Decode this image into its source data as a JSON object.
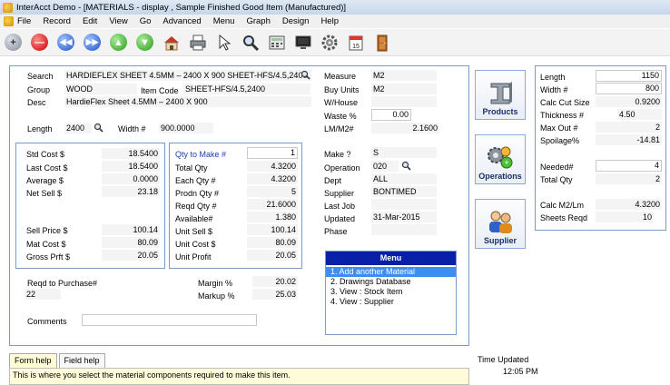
{
  "window": {
    "title": "InterAcct Demo - [MATERIALS - display , Sample Finished Good Item (Manufactured)]"
  },
  "menu": [
    "File",
    "Record",
    "Edit",
    "View",
    "Go",
    "Advanced",
    "Menu",
    "Graph",
    "Design",
    "Help"
  ],
  "toolbar": [
    "add-icon",
    "delete-icon",
    "first-icon",
    "last-icon",
    "previous-icon",
    "next-icon",
    "home-icon",
    "print-icon",
    "pointer-icon",
    "find-icon",
    "calculator-icon",
    "monitor-icon",
    "settings-icon",
    "calendar-icon",
    "exit-door-icon"
  ],
  "main": {
    "search": {
      "label": "Search",
      "value": "HARDIEFLEX SHEET 4.5MM – 2400 X 900 SHEET-HFS/4.5,2400"
    },
    "group": {
      "label": "Group",
      "value": "WOOD"
    },
    "item_code": {
      "label": "Item Code",
      "value": "SHEET-HFS/4.5,2400"
    },
    "desc": {
      "label": "Desc",
      "value": "HardieFlex Sheet 4.5MM – 2400 X 900"
    },
    "length": {
      "label": "Length",
      "value": "2400"
    },
    "width": {
      "label": "Width #",
      "value": "900.0000"
    },
    "measure": {
      "label": "Measure",
      "value": "M2"
    },
    "buy_units": {
      "label": "Buy Units",
      "value": "M2"
    },
    "w_house": {
      "label": "W/House",
      "value": ""
    },
    "waste": {
      "label": "Waste %",
      "value": "0.00"
    },
    "lm_m2": {
      "label": "LM/M2#",
      "value": "2.1600"
    }
  },
  "costs": {
    "std_cost": {
      "label": "Std Cost  $",
      "value": "18.5400"
    },
    "last_cost": {
      "label": "Last Cost  $",
      "value": "18.5400"
    },
    "average": {
      "label": "Average  $",
      "value": "0.0000"
    },
    "net_sell": {
      "label": "Net Sell  $",
      "value": "23.18"
    },
    "sell_price": {
      "label": "Sell Price $",
      "value": "100.14"
    },
    "mat_cost": {
      "label": "Mat Cost  $",
      "value": "80.09"
    },
    "gross_prft": {
      "label": "Gross Prft $",
      "value": "20.05"
    }
  },
  "qty": {
    "qty_to_make": {
      "label": "Qty to Make #",
      "value": "1"
    },
    "total_qty": {
      "label": "Total Qty",
      "value": "4.3200"
    },
    "each_qty": {
      "label": "Each Qty #",
      "value": "4.3200"
    },
    "prodn_qty": {
      "label": "Prodn Qty #",
      "value": "5"
    },
    "reqd_qty": {
      "label": "Reqd Qty #",
      "value": "21.6000"
    },
    "available": {
      "label": "Available#",
      "value": "1.380"
    },
    "unit_sell": {
      "label": "Unit Sell $",
      "value": "100.14"
    },
    "unit_cost": {
      "label": "Unit Cost $",
      "value": "80.09"
    },
    "unit_profit": {
      "label": "Unit Profit",
      "value": "20.05"
    }
  },
  "make": {
    "make": {
      "label": "Make ?",
      "value": "S"
    },
    "operation": {
      "label": "Operation",
      "value": "020"
    },
    "dept": {
      "label": "Dept",
      "value": "ALL"
    },
    "supplier": {
      "label": "Supplier",
      "value": "BONTIMED"
    },
    "last_job": {
      "label": "Last Job",
      "value": ""
    },
    "updated": {
      "label": "Updated",
      "value": "31-Mar-2015"
    },
    "phase": {
      "label": "Phase",
      "value": ""
    }
  },
  "bottom": {
    "reqd_purchase": {
      "label": "Reqd to Purchase#",
      "value": "22"
    },
    "margin": {
      "label": "Margin %",
      "value": "20.02"
    },
    "markup": {
      "label": "Markup %",
      "value": "25.03"
    },
    "comments": {
      "label": "Comments",
      "value": ""
    }
  },
  "actions": {
    "products": "Products",
    "operations": "Operations",
    "supplier": "Supplier"
  },
  "menu_panel": {
    "title": "Menu",
    "items": [
      "1. Add another Material",
      "2. Drawings Database",
      "3. View  : Stock Item",
      "4. View  : Supplier"
    ]
  },
  "right": {
    "length": {
      "label": "Length",
      "value": "1150"
    },
    "width": {
      "label": "Width #",
      "value": "800"
    },
    "calc_cut_size": {
      "label": "Calc Cut Size",
      "value": "0.9200"
    },
    "thickness": {
      "label": "Thickness #",
      "value": "4.50"
    },
    "max_out": {
      "label": "Max Out #",
      "value": "2"
    },
    "spoilage": {
      "label": "Spoilage%",
      "value": "-14.81"
    },
    "needed": {
      "label": "Needed#",
      "value": "4"
    },
    "total_qty": {
      "label": "Total Qty",
      "value": "2"
    },
    "calc_m2_lm": {
      "label": "Calc M2/Lm",
      "value": "4.3200"
    },
    "sheets_reqd": {
      "label": "Sheets Reqd",
      "value": "10"
    }
  },
  "help": {
    "tabs": [
      "Form help",
      "Field help"
    ],
    "text": "This is where you select the material components required to make this item."
  },
  "status": {
    "time_label": "Time Updated",
    "time_value": "12:05 PM"
  }
}
